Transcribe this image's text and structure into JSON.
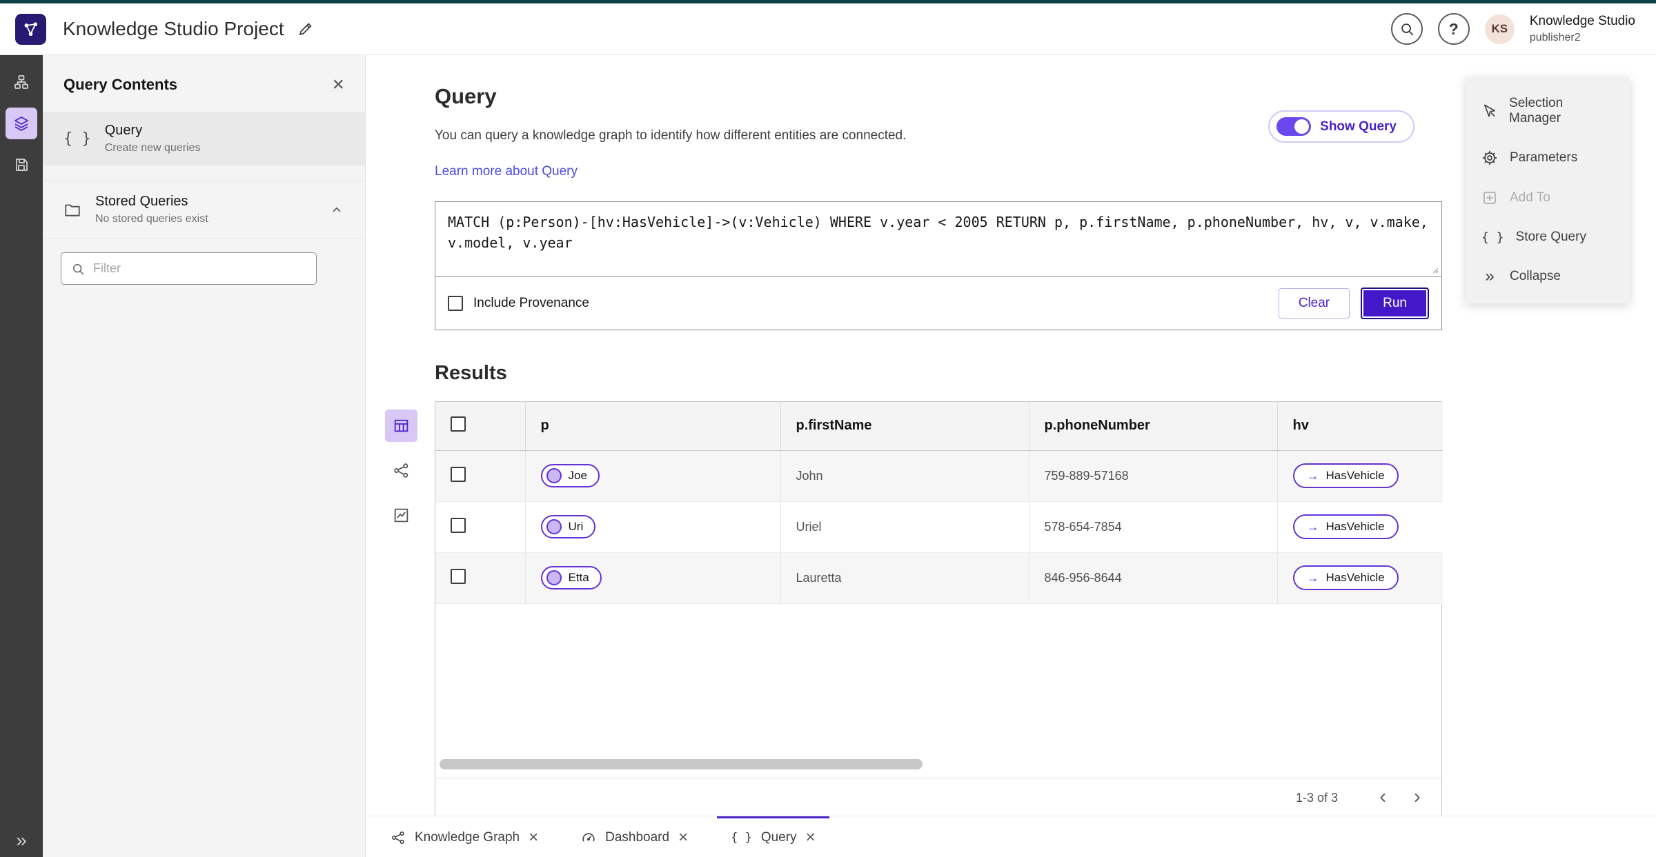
{
  "header": {
    "app_title": "Knowledge Studio Project",
    "account_name": "Knowledge Studio",
    "account_user": "publisher2",
    "avatar_initials": "KS",
    "help_glyph": "?"
  },
  "rail": {
    "expand_glyph": "»"
  },
  "left_panel": {
    "title": "Query Contents",
    "close_glyph": "×",
    "query_item": {
      "icon_glyph": "{ }",
      "title": "Query",
      "subtitle": "Create new queries"
    },
    "stored_queries": {
      "title": "Stored Queries",
      "subtitle": "No stored queries exist"
    },
    "filter": {
      "placeholder": "Filter"
    }
  },
  "query_section": {
    "title": "Query",
    "description": "You can query a knowledge graph to identify how different entities are connected.",
    "learn_more_link": "Learn more about Query",
    "show_query_label": "Show Query",
    "query_text": "MATCH (p:Person)-[hv:HasVehicle]->(v:Vehicle) WHERE v.year < 2005 RETURN p, p.firstName, p.phoneNumber, hv, v, v.make, v.model, v.year",
    "include_provenance_label": "Include Provenance",
    "clear_button": "Clear",
    "run_button": "Run"
  },
  "results": {
    "title": "Results",
    "columns": {
      "p": "p",
      "first_name": "p.firstName",
      "phone": "p.phoneNumber",
      "hv": "hv"
    },
    "rows": [
      {
        "p": "Joe",
        "first_name": "John",
        "phone": "759-889-57168",
        "hv": "HasVehicle"
      },
      {
        "p": "Uri",
        "first_name": "Uriel",
        "phone": "578-654-7854",
        "hv": "HasVehicle"
      },
      {
        "p": "Etta",
        "first_name": "Lauretta",
        "phone": "846-956-8644",
        "hv": "HasVehicle"
      }
    ],
    "edge_arrow_glyph": "→",
    "pagination": {
      "range_label": "1-3 of 3"
    }
  },
  "right_menu": {
    "selection_manager": "Selection Manager",
    "parameters": "Parameters",
    "add_to": "Add To",
    "store_query": "Store Query",
    "store_query_glyph": "{ }",
    "collapse": "Collapse",
    "collapse_glyph": "»"
  },
  "bottom_tabs": [
    {
      "label": "Knowledge Graph",
      "close_glyph": "×"
    },
    {
      "label": "Dashboard",
      "close_glyph": "×"
    },
    {
      "label": "Query",
      "icon_glyph": "{ }",
      "close_glyph": "×"
    }
  ],
  "colors": {
    "accent": "#4b23c9",
    "accent_light": "#d9c8f6",
    "link": "#4a4ce0",
    "rail_bg": "#3d3d3d",
    "top_strip": "#0b4247",
    "node_fill": "#cbb7f1",
    "pill_border": "#6333d6"
  }
}
